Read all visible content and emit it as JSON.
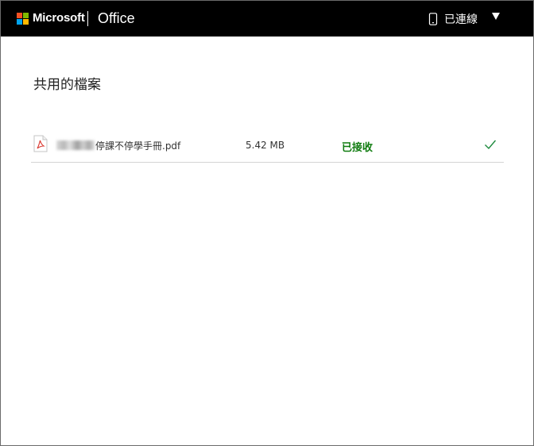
{
  "header": {
    "brand": "Microsoft",
    "product": "Office",
    "connection_status": "已連線",
    "logo_colors": [
      "#f25022",
      "#7fba00",
      "#00a4ef",
      "#ffb900"
    ],
    "icons": {
      "phone": "phone-icon",
      "dropdown": "caret-down-icon"
    }
  },
  "main": {
    "title": "共用的檔案",
    "files": [
      {
        "name": "停課不停學手冊.pdf",
        "size": "5.42 MB",
        "status": "已接收",
        "icon": "pdf-icon",
        "status_icon": "check-icon",
        "status_color": "#107c10"
      }
    ]
  }
}
